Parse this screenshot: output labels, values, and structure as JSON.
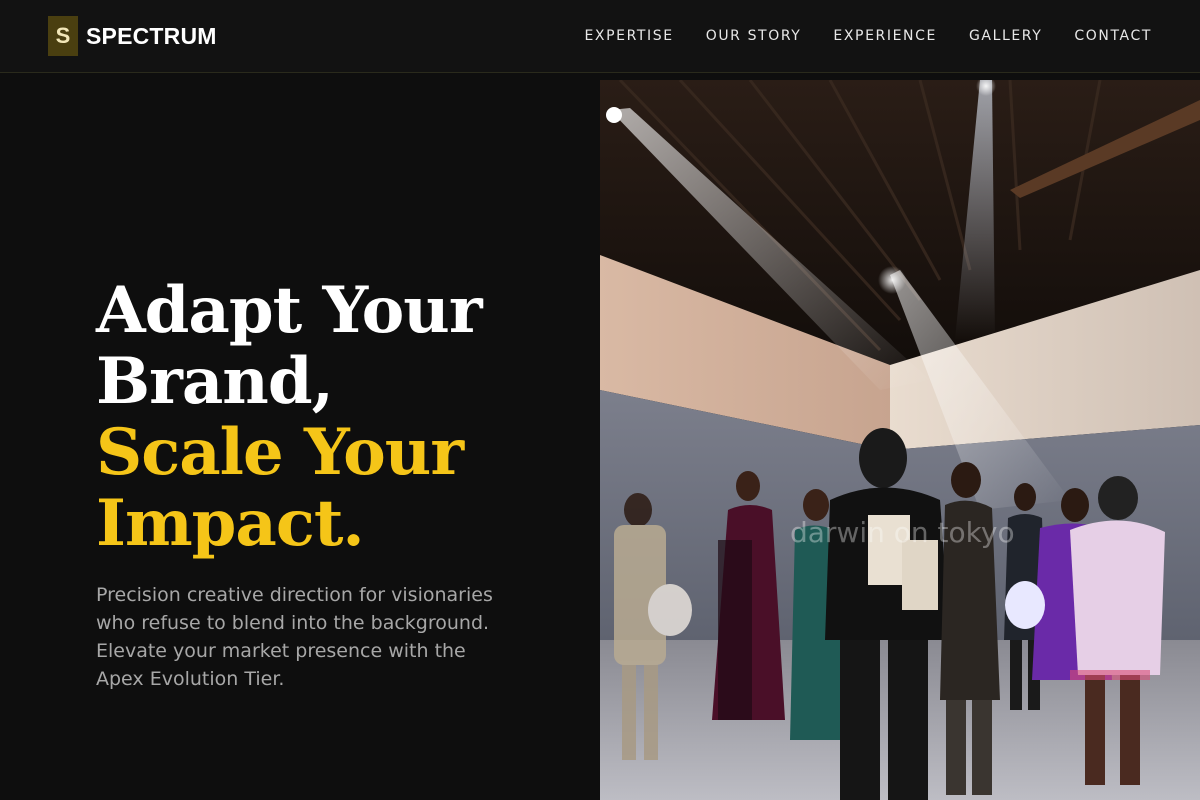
{
  "brand": {
    "mark": "S",
    "name": "SPECTRUM"
  },
  "nav": {
    "links": [
      "EXPERTISE",
      "OUR STORY",
      "EXPERIENCE",
      "GALLERY",
      "CONTACT"
    ]
  },
  "hero": {
    "headline_line1": "Adapt Your",
    "headline_line2": "Brand,",
    "headline_line3": "Scale Your",
    "headline_line4": "Impact.",
    "subtext": "Precision creative direction for visionaries who refuse to blend into the background. Elevate your market presence with the Apex Evolution Tier.",
    "image_watermark": "darwin on tokyo",
    "accent_color": "#f5c518"
  }
}
